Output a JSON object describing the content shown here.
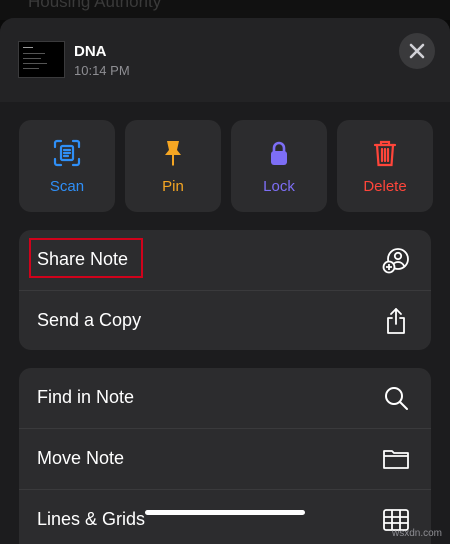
{
  "background": {
    "peek_text": "Housing Authority"
  },
  "note": {
    "title": "DNA",
    "time": "10:14 PM"
  },
  "header": {
    "close_icon": "close-icon"
  },
  "actions": [
    {
      "label": "Scan",
      "icon": "scan-icon",
      "color": "#2f8ff7"
    },
    {
      "label": "Pin",
      "icon": "pin-icon",
      "color": "#f5a623"
    },
    {
      "label": "Lock",
      "icon": "lock-icon",
      "color": "#7d6ef5"
    },
    {
      "label": "Delete",
      "icon": "trash-icon",
      "color": "#ff453a"
    }
  ],
  "share_group": [
    {
      "label": "Share Note",
      "icon": "share-person-icon"
    },
    {
      "label": "Send a Copy",
      "icon": "share-box-icon"
    }
  ],
  "tools_group": [
    {
      "label": "Find in Note",
      "icon": "search-icon"
    },
    {
      "label": "Move Note",
      "icon": "folder-icon"
    },
    {
      "label": "Lines & Grids",
      "icon": "grid-icon"
    }
  ],
  "watermark": "wsxdn.com",
  "colors": {
    "sheet": "#1c1c1e",
    "row_bg": "#2c2c2e",
    "highlight": "#d0021b"
  }
}
